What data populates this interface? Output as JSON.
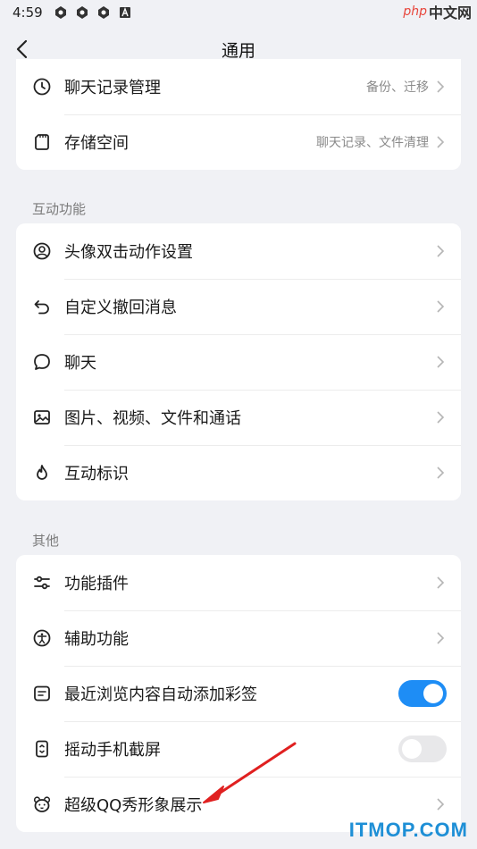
{
  "status_bar": {
    "time": "4:59"
  },
  "watermark_top": {
    "php": "php",
    "cn": "中文网"
  },
  "nav": {
    "title": "通用"
  },
  "card1": [
    {
      "label": "聊天记录管理",
      "value": "备份、迁移",
      "icon": "clock-icon"
    },
    {
      "label": "存储空间",
      "value": "聊天记录、文件清理",
      "icon": "sd-card-icon"
    }
  ],
  "section_interaction": {
    "title": "互动功能"
  },
  "card2": [
    {
      "label": "头像双击动作设置",
      "icon": "avatar-icon"
    },
    {
      "label": "自定义撤回消息",
      "icon": "undo-icon"
    },
    {
      "label": "聊天",
      "icon": "chat-bubble-icon"
    },
    {
      "label": "图片、视频、文件和通话",
      "icon": "image-icon"
    },
    {
      "label": "互动标识",
      "icon": "flame-icon"
    }
  ],
  "section_other": {
    "title": "其他"
  },
  "card3": [
    {
      "label": "功能插件",
      "icon": "sliders-icon"
    },
    {
      "label": "辅助功能",
      "icon": "accessibility-icon"
    },
    {
      "label": "最近浏览内容自动添加彩签",
      "icon": "note-icon",
      "toggle": true
    },
    {
      "label": "摇动手机截屏",
      "icon": "shake-screenshot-icon",
      "toggle": false
    },
    {
      "label": "超级QQ秀形象展示",
      "icon": "bear-face-icon"
    }
  ],
  "watermark_bottom": {
    "text": "ITMOP.COM"
  },
  "colors": {
    "accent": "#1e8df5",
    "background": "#f0f1f5",
    "arrow": "#e02020"
  }
}
